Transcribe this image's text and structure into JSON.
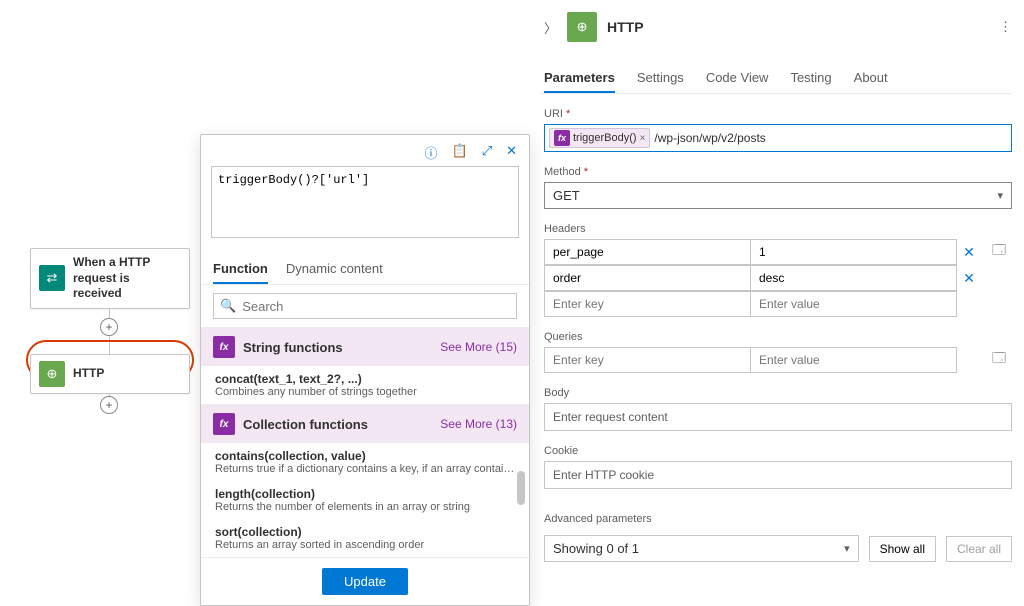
{
  "canvas": {
    "trigger_label": "When a HTTP request is received",
    "http_label": "HTTP",
    "plus": "+"
  },
  "popup": {
    "expression": "triggerBody()?['url']",
    "tab_function": "Function",
    "tab_dynamic": "Dynamic content",
    "search_placeholder": "Search",
    "cat_string": "String functions",
    "see_more_string": "See More (15)",
    "cat_collection": "Collection functions",
    "see_more_collection": "See More (13)",
    "funcs": {
      "concat_name": "concat(text_1, text_2?, ...)",
      "concat_desc": "Combines any number of strings together",
      "contains_name": "contains(collection, value)",
      "contains_desc": "Returns true if a dictionary contains a key, if an array contains a val...",
      "length_name": "length(collection)",
      "length_desc": "Returns the number of elements in an array or string",
      "sort_name": "sort(collection)",
      "sort_desc": "Returns an array sorted in ascending order"
    },
    "update": "Update"
  },
  "panel": {
    "title": "HTTP",
    "tabs": {
      "parameters": "Parameters",
      "settings": "Settings",
      "code_view": "Code View",
      "testing": "Testing",
      "about": "About"
    },
    "uri_label": "URI",
    "uri_token": "triggerBody()",
    "uri_token_x": "×",
    "uri_rest": "/wp-json/wp/v2/posts",
    "method_label": "Method",
    "method_value": "GET",
    "headers_label": "Headers",
    "headers": [
      {
        "k": "per_page",
        "v": "1"
      },
      {
        "k": "order",
        "v": "desc"
      }
    ],
    "enter_key": "Enter key",
    "enter_value": "Enter value",
    "queries_label": "Queries",
    "body_label": "Body",
    "body_placeholder": "Enter request content",
    "cookie_label": "Cookie",
    "cookie_placeholder": "Enter HTTP cookie",
    "advanced_label": "Advanced parameters",
    "advanced_showing": "Showing 0 of 1",
    "show_all": "Show all",
    "clear_all": "Clear all"
  }
}
